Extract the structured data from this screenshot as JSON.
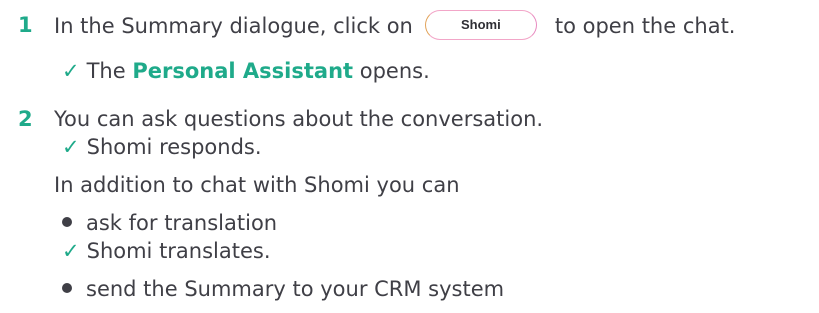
{
  "steps": [
    {
      "number": "1",
      "text_before": "In the Summary dialogue, click on",
      "button_label": "Shomi",
      "text_after": "to open the chat.",
      "result": {
        "check": "✓",
        "before": "The",
        "highlight": "Personal Assistant",
        "after": "opens."
      }
    },
    {
      "number": "2",
      "text": "You can ask questions about the conversation.",
      "result": {
        "check": "✓",
        "text": "Shomi responds."
      },
      "addition_intro": "In addition to chat with Shomi you can",
      "options": [
        {
          "text": "ask for translation",
          "result": {
            "check": "✓",
            "text": "Shomi translates."
          }
        },
        {
          "text": "send the Summary to your CRM system"
        }
      ]
    }
  ]
}
